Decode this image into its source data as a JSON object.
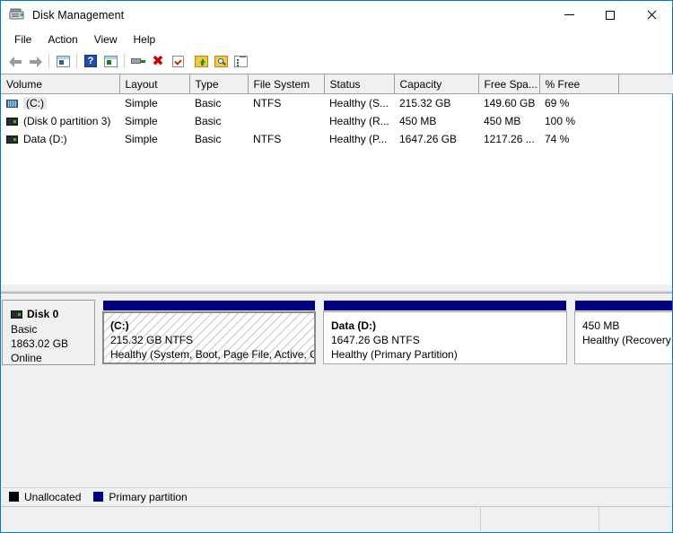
{
  "window": {
    "title": "Disk Management",
    "icon": "disk-management-icon",
    "controls": {
      "minimize": "minimize",
      "maximize": "maximize",
      "close": "close"
    }
  },
  "menu": {
    "items": [
      "File",
      "Action",
      "View",
      "Help"
    ]
  },
  "toolbar": {
    "buttons": [
      {
        "name": "back-icon",
        "label": "Back"
      },
      {
        "name": "forward-icon",
        "label": "Forward"
      },
      {
        "name": "show-hide-console-tree-icon",
        "label": "Show/Hide Console Tree"
      },
      {
        "name": "help-icon",
        "label": "Help"
      },
      {
        "name": "show-hide-action-pane-icon",
        "label": "Show/Hide Action Pane"
      },
      {
        "name": "rescan-disks-icon",
        "label": "Rescan Disks"
      },
      {
        "name": "delete-icon",
        "label": "Delete"
      },
      {
        "name": "properties-check-icon",
        "label": "Properties"
      },
      {
        "name": "folder-up-icon",
        "label": "Up One Level"
      },
      {
        "name": "folder-search-icon",
        "label": "Search"
      },
      {
        "name": "list-view-icon",
        "label": "List View"
      }
    ]
  },
  "volume_list": {
    "columns": [
      "Volume",
      "Layout",
      "Type",
      "File System",
      "Status",
      "Capacity",
      "Free Spa...",
      "% Free",
      ""
    ],
    "rows": [
      {
        "icon": "volume-striped-icon",
        "selected": true,
        "volume": "(C:)",
        "layout": "Simple",
        "type": "Basic",
        "file_system": "NTFS",
        "status": "Healthy (S...",
        "capacity": "215.32 GB",
        "free_space": "149.60 GB",
        "percent_free": "69 %"
      },
      {
        "icon": "volume-plain-icon",
        "selected": false,
        "volume": "(Disk 0 partition 3)",
        "layout": "Simple",
        "type": "Basic",
        "file_system": "",
        "status": "Healthy (R...",
        "capacity": "450 MB",
        "free_space": "450 MB",
        "percent_free": "100 %"
      },
      {
        "icon": "volume-plain-icon",
        "selected": false,
        "volume": "Data (D:)",
        "layout": "Simple",
        "type": "Basic",
        "file_system": "NTFS",
        "status": "Healthy (P...",
        "capacity": "1647.26 GB",
        "free_space": "1217.26 ...",
        "percent_free": "74 %"
      }
    ]
  },
  "graphic_view": {
    "disk": {
      "name": "Disk 0",
      "type": "Basic",
      "size": "1863.02 GB",
      "state": "Online",
      "icon": "disk-icon"
    },
    "partitions": [
      {
        "name": "(C:)",
        "size_fs": "215.32 GB NTFS",
        "status": "Healthy (System, Boot, Page File, Active, Cr",
        "selected": true,
        "bar_color": "#000080"
      },
      {
        "name": "Data  (D:)",
        "size_fs": "1647.26 GB NTFS",
        "status": "Healthy (Primary Partition)",
        "selected": false,
        "bar_color": "#000080"
      },
      {
        "name": "",
        "size_fs": "450 MB",
        "status": "Healthy (Recovery P",
        "selected": false,
        "bar_color": "#000080"
      }
    ]
  },
  "legend": {
    "items": [
      {
        "label": "Unallocated",
        "color": "#000000",
        "swatch": "unalloc"
      },
      {
        "label": "Primary partition",
        "color": "#000080",
        "swatch": "primary"
      }
    ]
  },
  "status_bar": {
    "panes": [
      "",
      "",
      ""
    ]
  }
}
